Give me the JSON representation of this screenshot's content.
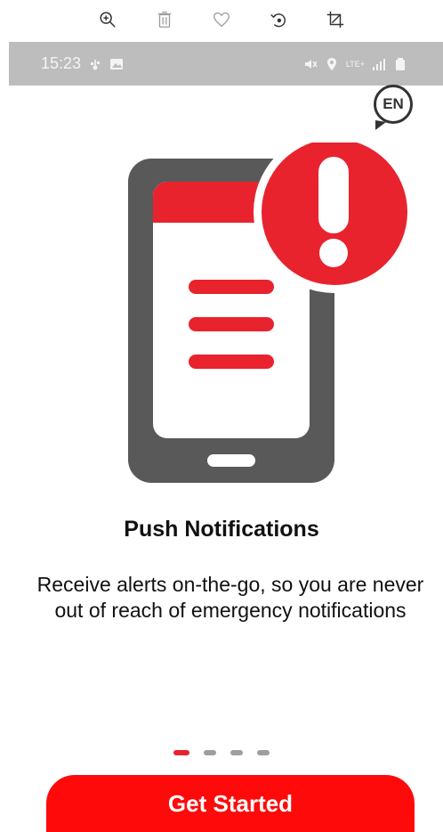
{
  "toolbar": {
    "icons": [
      "zoom-in-icon",
      "trash-icon",
      "heart-icon",
      "rotate-icon",
      "crop-icon"
    ]
  },
  "status_bar": {
    "time": "15:23",
    "lte_label": "LTE+"
  },
  "language": {
    "code": "EN"
  },
  "onboarding": {
    "title": "Push Notifications",
    "description": "Receive alerts on-the-go, so you are never out of reach of emergency notifications",
    "page_index": 1,
    "page_count": 4
  },
  "cta": {
    "label": "Get Started"
  },
  "colors": {
    "accent": "#e8232e",
    "button": "#ff0a0a",
    "phone": "#595959",
    "status_bar": "#bdbdbd"
  }
}
